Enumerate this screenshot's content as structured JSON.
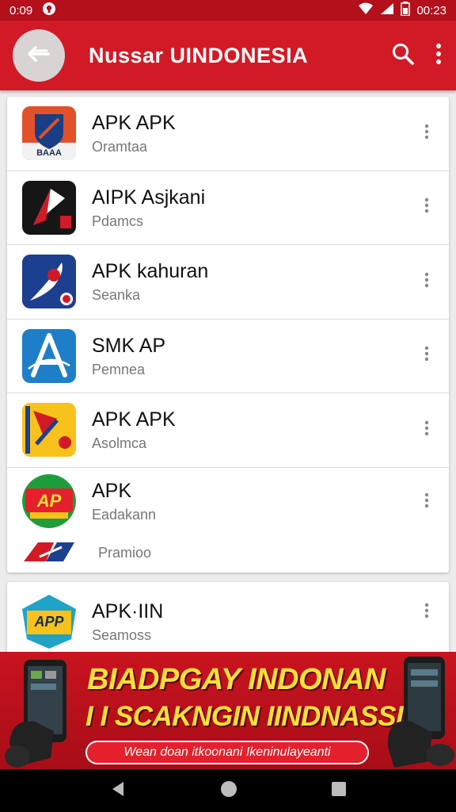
{
  "status_bar": {
    "time_left": "0:09",
    "time_right": "00:23",
    "icons": [
      "notification-icon",
      "wifi-icon",
      "signal-icon",
      "battery-icon"
    ]
  },
  "app_bar": {
    "title": "Nussar UINDONESIA",
    "back_icon": "arrow-left-icon",
    "search_icon": "search-icon",
    "menu_icon": "more-vert-icon"
  },
  "list": [
    {
      "title": "APK APK",
      "subtitle": "Oramtaa",
      "icon": "shield-app-icon"
    },
    {
      "title": "AIPK Asjkani",
      "subtitle": "Pdamcs",
      "icon": "rocket-app-icon"
    },
    {
      "title": "APK kahuran",
      "subtitle": "Seanka",
      "icon": "rocket-badge-app-icon"
    },
    {
      "title": "SMK AP",
      "subtitle": "Pemnea",
      "icon": "letter-a-app-icon"
    },
    {
      "title": "APK APK",
      "subtitle": "Asolmca",
      "icon": "yellow-arrow-app-icon"
    },
    {
      "title": "APK",
      "subtitle": "Eadakann",
      "icon": "ap-badge-app-icon",
      "extra_subtitle": "Pramioo"
    }
  ],
  "second_card": {
    "title": "APK·IIN",
    "subtitle": "Seamoss",
    "icon": "api-badge-app-icon",
    "icon_text": "APP"
  },
  "banner": {
    "line1": "BIADPGAY INDONAN",
    "line2": "I I SCAKNGIN IINDNASSIO",
    "tagline": "Wean doan itkoonani Ikeninulayeanti"
  },
  "nav_bar": {
    "back": "back-icon",
    "home": "home-icon",
    "recents": "recents-icon"
  },
  "colors": {
    "primary": "#d21a26",
    "status_bar": "#b3101c",
    "banner_text": "#ffe23a"
  }
}
